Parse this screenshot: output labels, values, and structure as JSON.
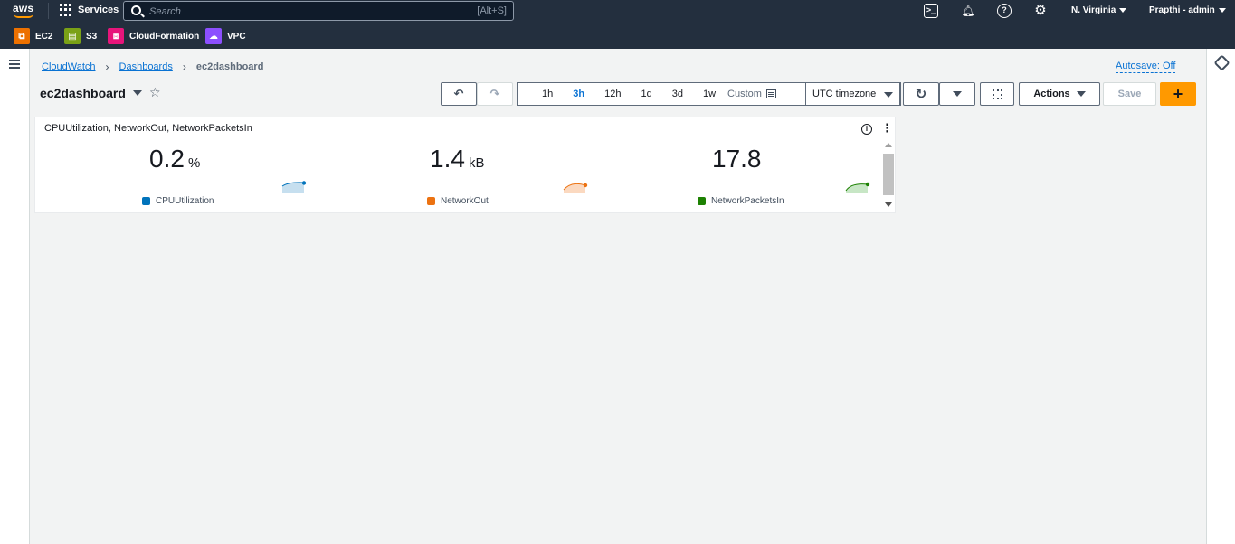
{
  "topnav": {
    "logo": "aws",
    "services_label": "Services",
    "search_placeholder": "Search",
    "search_shortcut": "[Alt+S]",
    "region": "N. Virginia",
    "user": "Prapthi - admin"
  },
  "favorites": [
    {
      "label": "EC2",
      "color": "#ed7100"
    },
    {
      "label": "S3",
      "color": "#7aa116"
    },
    {
      "label": "CloudFormation",
      "color": "#e7157b"
    },
    {
      "label": "VPC",
      "color": "#8c4fff"
    }
  ],
  "breadcrumb": {
    "items": [
      "CloudWatch",
      "Dashboards",
      "ec2dashboard"
    ]
  },
  "autosave": "Autosave: Off",
  "dashboard": {
    "title": "ec2dashboard"
  },
  "toolbar": {
    "time_ranges": [
      "1h",
      "3h",
      "12h",
      "1d",
      "3d",
      "1w"
    ],
    "active_range": "3h",
    "custom_label": "Custom",
    "timezone": "UTC timezone",
    "actions_label": "Actions",
    "save_label": "Save",
    "add_label": "+"
  },
  "widget": {
    "title": "CPUUtilization, NetworkOut, NetworkPacketsIn",
    "metrics": [
      {
        "value": "0.2",
        "unit": "%",
        "label": "CPUUtilization",
        "color": "#0073bb"
      },
      {
        "value": "1.4",
        "unit": "kB",
        "label": "NetworkOut",
        "color": "#ec7211"
      },
      {
        "value": "17.8",
        "unit": "",
        "label": "NetworkPacketsIn",
        "color": "#1d8102"
      }
    ]
  }
}
